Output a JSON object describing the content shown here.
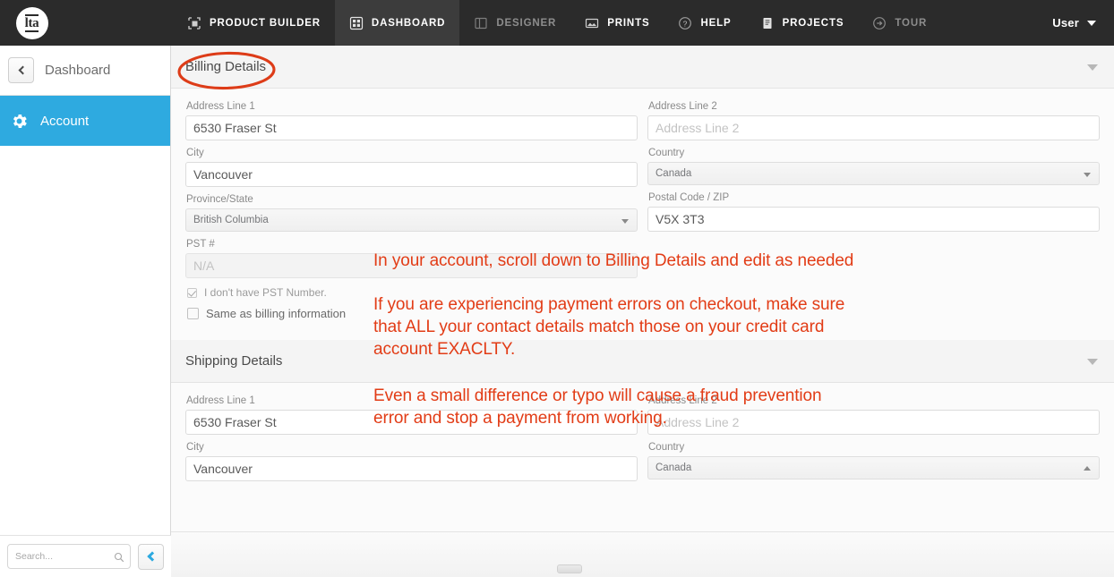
{
  "topnav": {
    "brand": {
      "icon": "lta-logo-icon",
      "text": "lta"
    },
    "items": [
      {
        "label": "PRODUCT BUILDER",
        "icon": "crop-frame-icon",
        "active": false,
        "dim": false
      },
      {
        "label": "DASHBOARD",
        "icon": "grid-squares-icon",
        "active": true,
        "dim": false
      },
      {
        "label": "DESIGNER",
        "icon": "layout-panel-icon",
        "active": false,
        "dim": true
      },
      {
        "label": "PRINTS",
        "icon": "picture-icon",
        "active": false,
        "dim": false
      },
      {
        "label": "HELP",
        "icon": "question-circle-icon",
        "active": false,
        "dim": false
      },
      {
        "label": "PROJECTS",
        "icon": "document-icon",
        "active": false,
        "dim": false
      },
      {
        "label": "TOUR",
        "icon": "arrow-right-circle-icon",
        "active": false,
        "dim": true
      }
    ],
    "user": {
      "label": "User",
      "caret_icon": "caret-down-icon"
    }
  },
  "sidebar": {
    "back": {
      "label": "Dashboard",
      "icon": "chevron-left-icon"
    },
    "items": [
      {
        "label": "Account",
        "icon": "gear-icon",
        "active": true
      }
    ],
    "footer": {
      "search_placeholder": "Search...",
      "search_value": "",
      "search_icon": "magnifier-icon",
      "collapse_icon": "chevron-left-icon"
    }
  },
  "main": {
    "sections": [
      {
        "title": "Billing Details",
        "chevron_icon": "chevron-down-icon",
        "fields": [
          {
            "label": "Address Line 1",
            "type": "text",
            "value": "6530 Fraser St",
            "placeholder": "Address Line 1",
            "col": "left",
            "name": "billing-address-line-1"
          },
          {
            "label": "Address Line 2",
            "type": "text",
            "value": "",
            "placeholder": "Address Line 2",
            "col": "right",
            "name": "billing-address-line-2"
          },
          {
            "label": "City",
            "type": "text",
            "value": "Vancouver",
            "placeholder": "City",
            "col": "left",
            "name": "billing-city"
          },
          {
            "label": "Country",
            "type": "select",
            "value": "Canada",
            "arrow": "down",
            "col": "right",
            "name": "billing-country"
          },
          {
            "label": "Province/State",
            "type": "select",
            "value": "British Columbia",
            "arrow": "down",
            "col": "left",
            "name": "billing-province"
          },
          {
            "label": "Postal Code / ZIP",
            "type": "text",
            "value": "V5X 3T3",
            "placeholder": "Postal Code / ZIP",
            "col": "right",
            "name": "billing-postal-code"
          },
          {
            "label": "PST #",
            "type": "text",
            "value": "",
            "placeholder": "N/A",
            "disabled": true,
            "col": "left",
            "name": "billing-pst-number"
          }
        ],
        "checkboxes": [
          {
            "label": "I don't have PST Number.",
            "checked": true,
            "style": "muted",
            "name": "no-pst-number-checkbox"
          },
          {
            "label": "Same as billing information",
            "checked": false,
            "style": "dark",
            "name": "same-as-billing-checkbox"
          }
        ]
      },
      {
        "title": "Shipping Details",
        "chevron_icon": "chevron-down-icon",
        "fields": [
          {
            "label": "Address Line 1",
            "type": "text",
            "value": "6530 Fraser St",
            "placeholder": "Address Line 1",
            "col": "left",
            "name": "shipping-address-line-1"
          },
          {
            "label": "Address Line 2",
            "type": "text",
            "value": "",
            "placeholder": "Address Line 2",
            "col": "right",
            "name": "shipping-address-line-2"
          },
          {
            "label": "City",
            "type": "text",
            "value": "Vancouver",
            "placeholder": "City",
            "col": "left",
            "name": "shipping-city"
          },
          {
            "label": "Country",
            "type": "select",
            "value": "Canada",
            "arrow": "up",
            "col": "right",
            "name": "shipping-country"
          }
        ]
      }
    ]
  },
  "annotations": {
    "ellipse_target": "Billing Details",
    "note_1": "In your account, scroll down to Billing Details and edit as needed",
    "note_2": "If you are experiencing payment errors on checkout, make sure that ALL your contact details match those on your credit card account EXACLTY.",
    "note_3": "Even a small difference or typo will cause a fraud prevention error and stop a payment from working."
  },
  "colors": {
    "topnav_bg": "#2b2b2b",
    "topnav_active_bg": "#3c3c3c",
    "accent_blue": "#2eaae0",
    "annotation_red": "#e23c16",
    "section_header_bg": "#f4f4f4",
    "page_bg": "#fbfbfb"
  }
}
